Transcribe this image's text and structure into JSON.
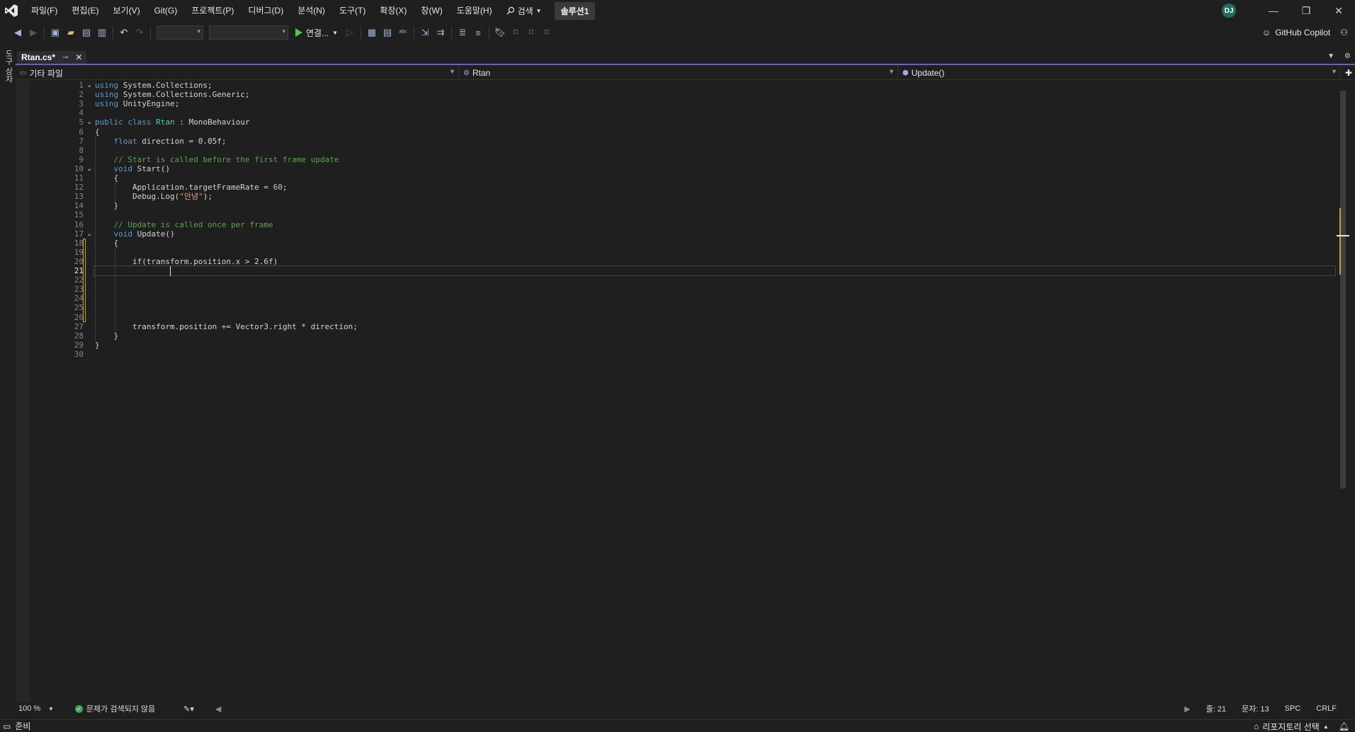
{
  "menu": {
    "items": [
      "파일(F)",
      "편집(E)",
      "보기(V)",
      "Git(G)",
      "프로젝트(P)",
      "디버그(D)",
      "분석(N)",
      "도구(T)",
      "확장(X)",
      "창(W)",
      "도움말(H)"
    ],
    "search_label": "검색",
    "solution_name": "솔루션1",
    "avatar_initials": "DJ"
  },
  "toolbar": {
    "run_label": "연결...",
    "copilot_label": "GitHub Copilot"
  },
  "left_strip": {
    "label": "도구 상자"
  },
  "tab": {
    "name": "Rtan.cs*",
    "pin_icon": "pin-icon",
    "close_icon": "close-icon"
  },
  "navbar": {
    "project": "기타 파일",
    "type": "Rtan",
    "member": "Update()"
  },
  "editor": {
    "active_line": 21,
    "lines": [
      [
        {
          "t": "using",
          "c": "kw"
        },
        {
          "t": " System.Collections;"
        }
      ],
      [
        {
          "t": "using",
          "c": "kw"
        },
        {
          "t": " System.Collections.Generic;"
        }
      ],
      [
        {
          "t": "using",
          "c": "kw"
        },
        {
          "t": " UnityEngine;"
        }
      ],
      [],
      [
        {
          "t": "public",
          "c": "kw"
        },
        {
          "t": " "
        },
        {
          "t": "class",
          "c": "kw"
        },
        {
          "t": " "
        },
        {
          "t": "Rtan",
          "c": "ty"
        },
        {
          "t": " : MonoBehaviour"
        }
      ],
      [
        {
          "t": "{"
        }
      ],
      [
        {
          "t": "    "
        },
        {
          "t": "float",
          "c": "kw"
        },
        {
          "t": " direction = 0.05f;"
        }
      ],
      [],
      [
        {
          "t": "    "
        },
        {
          "t": "// Start is called before the first frame update",
          "c": "cm"
        }
      ],
      [
        {
          "t": "    "
        },
        {
          "t": "void",
          "c": "kw"
        },
        {
          "t": " Start()"
        }
      ],
      [
        {
          "t": "    {"
        }
      ],
      [
        {
          "t": "        Application.targetFrameRate = "
        },
        {
          "t": "60",
          "c": "nm"
        },
        {
          "t": ";"
        }
      ],
      [
        {
          "t": "        Debug.Log("
        },
        {
          "t": "\"안녕\"",
          "c": "st"
        },
        {
          "t": ");"
        }
      ],
      [
        {
          "t": "    }"
        }
      ],
      [],
      [
        {
          "t": "    "
        },
        {
          "t": "// Update is called once per frame",
          "c": "cm"
        }
      ],
      [
        {
          "t": "    "
        },
        {
          "t": "void",
          "c": "kw"
        },
        {
          "t": " Update()"
        }
      ],
      [
        {
          "t": "    {"
        }
      ],
      [],
      [
        {
          "t": "        if(transform.position.x > 2.6f)"
        }
      ],
      [],
      [],
      [],
      [],
      [],
      [],
      [
        {
          "t": "        transform.position += Vector3.right * direction;"
        }
      ],
      [
        {
          "t": "    }"
        }
      ],
      [
        {
          "t": "}"
        }
      ],
      []
    ],
    "fold_lines": [
      1,
      5,
      10,
      17
    ]
  },
  "editor_status": {
    "zoom": "100 %",
    "issues": "문제가 검색되지 않음",
    "line": "줄: 21",
    "column": "문자: 13",
    "whitespace": "SPC",
    "line_ending": "CRLF"
  },
  "statusbar": {
    "ready": "준비",
    "repo": "리포지토리 선택"
  },
  "colors": {
    "background": "#1f1f1f",
    "keyword": "#569cd6",
    "type": "#4ec9b0",
    "comment": "#57a64a",
    "string": "#d69d85",
    "accent": "#6e5bbf",
    "change_marker": "#c9a227"
  }
}
